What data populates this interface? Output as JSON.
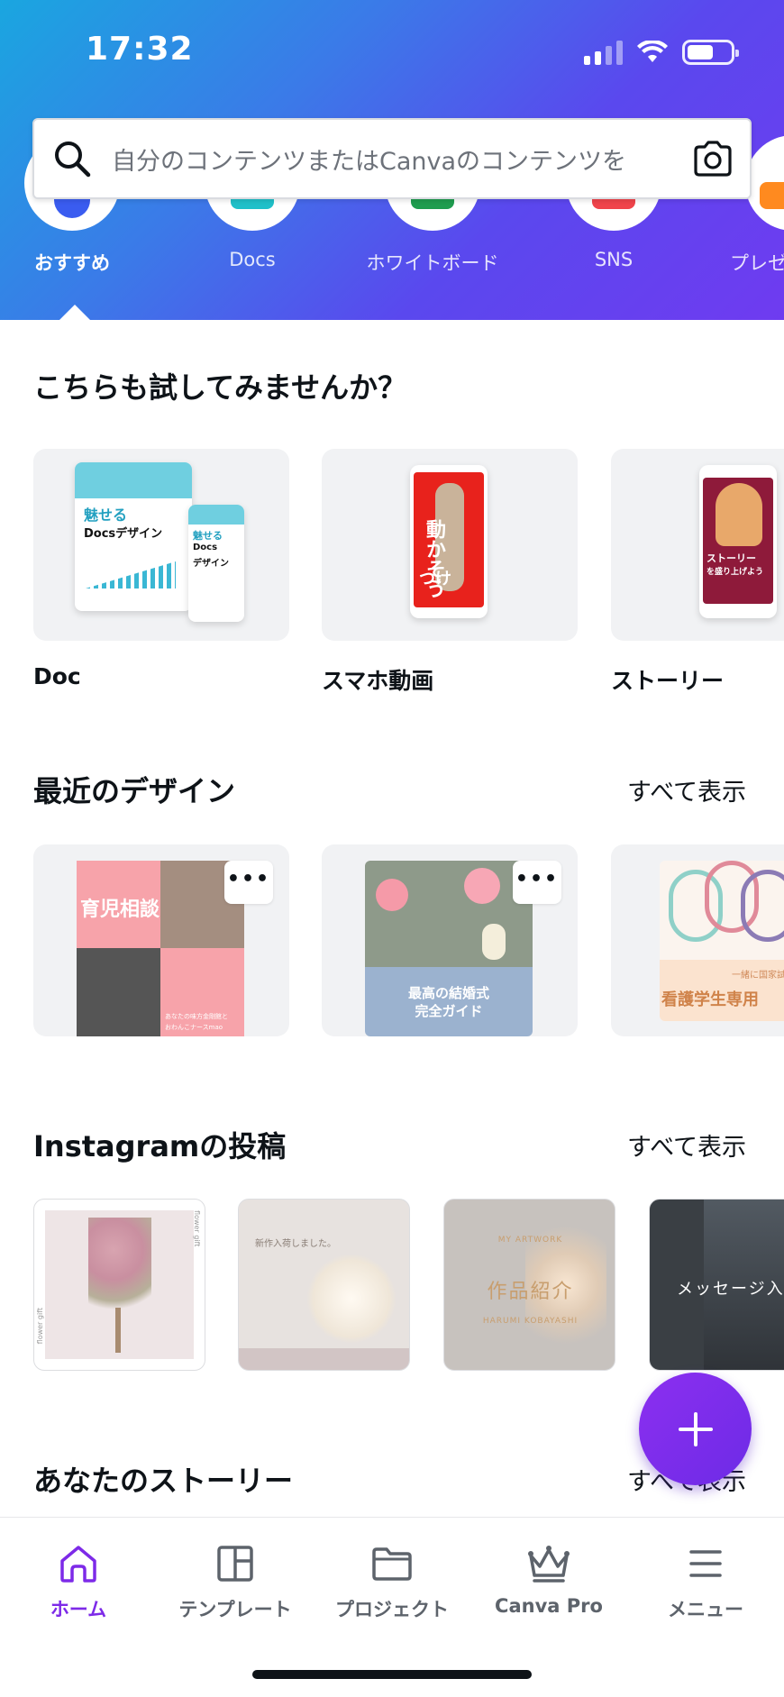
{
  "status_bar": {
    "time": "17:32"
  },
  "search": {
    "placeholder": "自分のコンテンツまたはCanvaのコンテンツを"
  },
  "categories": [
    {
      "label": "おすすめ",
      "icon": "star-icon",
      "active": true
    },
    {
      "label": "Docs",
      "icon": "docs-icon"
    },
    {
      "label": "ホワイトボード",
      "icon": "whiteboard-icon"
    },
    {
      "label": "SNS",
      "icon": "heart-icon"
    },
    {
      "label": "プレゼ",
      "icon": "presentation-icon"
    }
  ],
  "suggestions": {
    "title": "こちらも試してみませんか？",
    "items": [
      {
        "label": "Doc",
        "thumb_text": [
          "魅せる",
          "Docsデザイン",
          "魅せる",
          "Docs",
          "デザイン"
        ]
      },
      {
        "label": "スマホ動画",
        "thumb_text": [
          "動かそう",
          "つけ"
        ]
      },
      {
        "label": "ストーリー",
        "thumb_text": [
          "ストーリー",
          "を盛り上げよう"
        ]
      }
    ]
  },
  "recent": {
    "title": "最近のデザイン",
    "see_all": "すべて表示",
    "items": [
      {
        "name": "育児相談",
        "thumb_text": [
          "育児相談",
          "あなたの味方金剛館と",
          "おわんこナースmao"
        ]
      },
      {
        "name": "最高の結婚式 完全ガイド",
        "thumb_text": [
          "最高の結婚式",
          "完全ガイド"
        ]
      },
      {
        "name": "看護学生専用",
        "thumb_text": [
          "看護学生専用",
          "一緒に国家試験"
        ]
      }
    ]
  },
  "instagram": {
    "title": "Instagramの投稿",
    "see_all": "すべて表示",
    "items": [
      {
        "caption": "flower gift"
      },
      {
        "caption": "新作入荷しました。"
      },
      {
        "caption": "作品紹介",
        "sub": "MY ARTWORK",
        "author": "HARUMI KOBAYASHI"
      },
      {
        "caption": "メッセージ入"
      }
    ]
  },
  "stories": {
    "title": "あなたのストーリー",
    "see_all": "すべて表示"
  },
  "bottom_nav": [
    {
      "label": "ホーム",
      "icon": "home-icon",
      "active": true
    },
    {
      "label": "テンプレート",
      "icon": "template-icon"
    },
    {
      "label": "プロジェクト",
      "icon": "folder-icon"
    },
    {
      "label": "Canva Pro",
      "icon": "crown-icon"
    },
    {
      "label": "メニュー",
      "icon": "menu-icon"
    }
  ],
  "colors": {
    "accent": "#7d2ae8",
    "header_start": "#1aa6e0",
    "header_end": "#6f3bf0"
  }
}
